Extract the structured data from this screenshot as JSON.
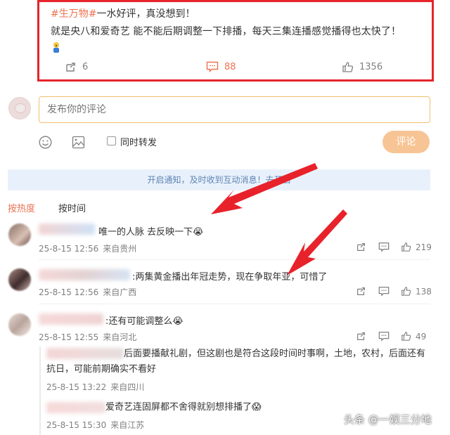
{
  "post": {
    "topic": "#生万物#",
    "line1_rest": "一水好评，真没想到！",
    "line2": "就是央八和爱奇艺 能不能后期调整一下排播，每天三集连播感觉播得也太快了！",
    "actions": {
      "repost_count": "6",
      "comment_count": "88",
      "like_count": "1356"
    }
  },
  "composer": {
    "placeholder": "发布你的评论",
    "repost_label": "同时转发",
    "submit_label": "评论"
  },
  "notify": {
    "text": "开启通知，及时收到互动消息！去开启"
  },
  "sort": {
    "hot": "按热度",
    "time": "按时间"
  },
  "comments": [
    {
      "text": "唯一的人脉 去反映一下😭",
      "time": "25-8-15 12:56",
      "location": "来自贵州",
      "likes": "219"
    },
    {
      "text": ":两集黄金播出年冠走势，现在争取年亚，可惜了",
      "time": "25-8-15 12:56",
      "location": "来自广西",
      "likes": "138"
    },
    {
      "text": ":还有可能调整么😭",
      "time": "25-8-15 12:55",
      "location": "来自河北",
      "likes": "49"
    }
  ],
  "replies": [
    {
      "text_line1": "后面要播献礼剧，但这剧也是符合这段时间时事啊，土地，农村，后面还有",
      "text_line2": "抗日，可能前期确实不看好",
      "time": "25-8-15 13:22",
      "location": "来自四川"
    },
    {
      "text": "爱奇艺连固屏都不舍得就别想排播了😱",
      "time": "25-8-15 15:30",
      "location": "来自江苏"
    }
  ],
  "watermark": "头条 @一娱三分地",
  "colors": {
    "accent_orange": "#eb7350",
    "highlight_red": "#e5242b",
    "banner_bg": "#e8f1fb",
    "banner_text": "#5f84b5",
    "submit_bg": "#f7c595"
  }
}
